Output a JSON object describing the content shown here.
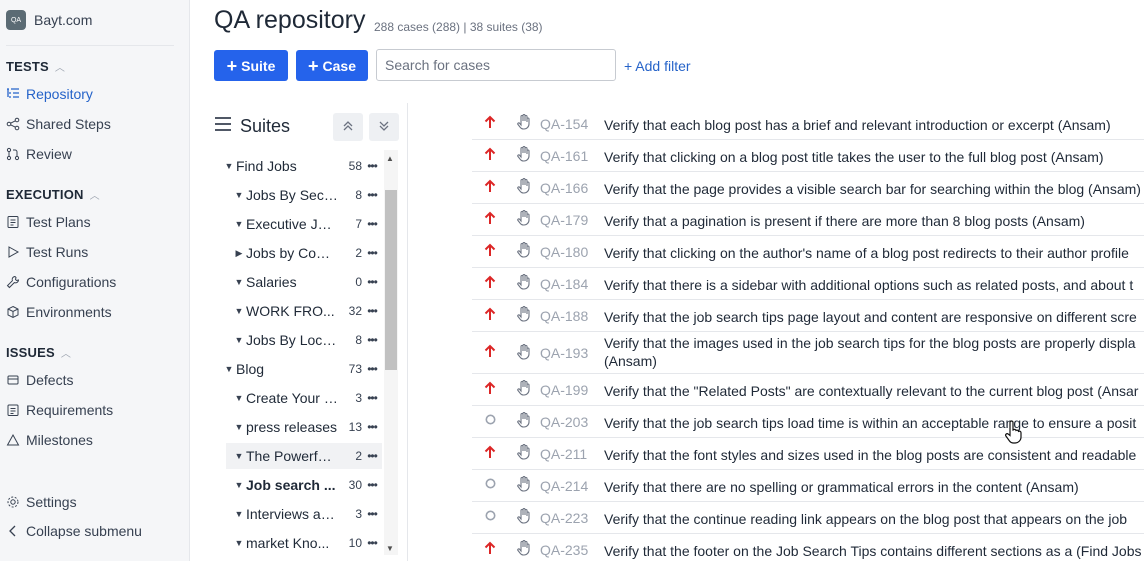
{
  "app": {
    "logo_text": "QA",
    "name": "Bayt.com"
  },
  "sidebar": {
    "tests_heading": "TESTS",
    "tests_items": [
      {
        "label": "Repository",
        "icon": "list-tree-icon",
        "active": true
      },
      {
        "label": "Shared Steps",
        "icon": "share-icon"
      },
      {
        "label": "Review",
        "icon": "git-pull-request-icon"
      }
    ],
    "execution_heading": "EXECUTION",
    "execution_items": [
      {
        "label": "Test Plans",
        "icon": "document-icon"
      },
      {
        "label": "Test Runs",
        "icon": "play-icon"
      },
      {
        "label": "Configurations",
        "icon": "wrench-icon"
      },
      {
        "label": "Environments",
        "icon": "cube-icon"
      }
    ],
    "issues_heading": "ISSUES",
    "issues_items": [
      {
        "label": "Defects",
        "icon": "bug-icon"
      },
      {
        "label": "Requirements",
        "icon": "clipboard-icon"
      },
      {
        "label": "Milestones",
        "icon": "triangle-icon"
      }
    ],
    "settings_label": "Settings",
    "collapse_label": "Collapse submenu"
  },
  "header": {
    "title": "QA repository",
    "subtitle": "288 cases (288) | 38 suites (38)",
    "suite_button": "Suite",
    "case_button": "Case",
    "search_placeholder": "Search for cases",
    "add_filter": "+ Add filter"
  },
  "suites": {
    "title": "Suites",
    "items": [
      {
        "label": "Find Jobs",
        "count": "58",
        "level": 0,
        "expanded": true
      },
      {
        "label": "Jobs By Sector",
        "count": "8",
        "level": 1,
        "expanded": true
      },
      {
        "label": "Executive Jobs",
        "count": "7",
        "level": 1,
        "expanded": true
      },
      {
        "label": "Jobs by Com...",
        "count": "2",
        "level": 1,
        "expanded": false
      },
      {
        "label": "Salaries",
        "count": "0",
        "level": 1,
        "expanded": true
      },
      {
        "label": "WORK FRO...",
        "count": "32",
        "level": 1,
        "expanded": true
      },
      {
        "label": "Jobs By Loca...",
        "count": "8",
        "level": 1,
        "expanded": true
      },
      {
        "label": "Blog",
        "count": "73",
        "level": 0,
        "expanded": true
      },
      {
        "label": "Create Your CV",
        "count": "3",
        "level": 1,
        "expanded": true
      },
      {
        "label": "press releases",
        "count": "13",
        "level": 1,
        "expanded": true
      },
      {
        "label": "The Powerful...",
        "count": "2",
        "level": 1,
        "expanded": true,
        "selected": true
      },
      {
        "label": "Job search ...",
        "count": "30",
        "level": 1,
        "expanded": true,
        "bold": true
      },
      {
        "label": "Interviews an...",
        "count": "3",
        "level": 1,
        "expanded": true
      },
      {
        "label": "market Kno...",
        "count": "10",
        "level": 1,
        "expanded": true
      }
    ]
  },
  "cases": [
    {
      "id": "QA-154",
      "priority": "high",
      "title": "Verify that each blog post has a brief and relevant introduction or excerpt (Ansam)"
    },
    {
      "id": "QA-161",
      "priority": "high",
      "title": "Verify that clicking on a blog post title takes the user to the full blog post (Ansam)"
    },
    {
      "id": "QA-166",
      "priority": "high",
      "title": "Verify that the page provides a visible search bar for searching within the blog (Ansam)"
    },
    {
      "id": "QA-179",
      "priority": "high",
      "title": "Verify that a pagination is present if there are more than 8 blog posts (Ansam)"
    },
    {
      "id": "QA-180",
      "priority": "high",
      "title": "Verify that clicking on the author's name of a blog post redirects to their author profile"
    },
    {
      "id": "QA-184",
      "priority": "high",
      "title": "Verify that there is a sidebar with additional options such as related posts, and about t"
    },
    {
      "id": "QA-188",
      "priority": "high",
      "title": "Verify that the job search tips page layout and content are responsive on different scre"
    },
    {
      "id": "QA-193",
      "priority": "high",
      "title": "Verify that the images used in the job search tips for the blog posts are properly displa",
      "title2": "(Ansam)"
    },
    {
      "id": "QA-199",
      "priority": "high",
      "title": "Verify that the \"Related Posts\" are contextually relevant to the current blog post (Ansar"
    },
    {
      "id": "QA-203",
      "priority": "low",
      "title": "Verify that the job search tips load time is within an acceptable range to ensure a posit"
    },
    {
      "id": "QA-211",
      "priority": "high",
      "title": "Verify that the font styles and sizes used in the blog posts are consistent and readable"
    },
    {
      "id": "QA-214",
      "priority": "low",
      "title": "Verify that there are no spelling or grammatical errors in the content (Ansam)"
    },
    {
      "id": "QA-223",
      "priority": "low",
      "title": "Verify that the continue reading link appears on the blog post that appears on the job"
    },
    {
      "id": "QA-235",
      "priority": "high",
      "title": "Verify that the footer on the Job Search Tips contains different sections as a (Find Jobs"
    }
  ]
}
